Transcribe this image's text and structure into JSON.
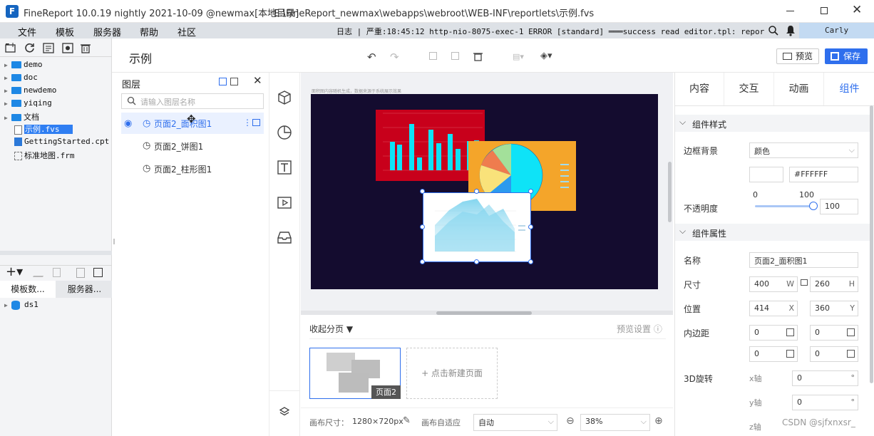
{
  "window": {
    "title": "FineReport 10.0.19 nightly 2021-10-09 @newmax[本地目录]",
    "path": "E:\\FineReport_newmax\\webapps\\webroot\\WEB-INF\\reportlets\\示例.fvs"
  },
  "menu": [
    "文件",
    "模板",
    "服务器",
    "帮助",
    "社区"
  ],
  "log": "日志 | 严重:18:45:12 http-nio-8075-exec-1 ERROR [standard] ═══success read editor.tpl: reportle...",
  "user": "Carly",
  "tree": {
    "items": [
      "demo",
      "doc",
      "newdemo",
      "yiqing",
      "文档",
      "示例.fvs",
      "GettingStarted.cpt",
      "标准地图.frm"
    ]
  },
  "datasource": {
    "tabs": [
      "模板数...",
      "服务器..."
    ],
    "item": "ds1"
  },
  "header": {
    "title": "示例",
    "preview": "预览",
    "save": "保存"
  },
  "layers": {
    "title": "图层",
    "search_placeholder": "请输入图层名称",
    "items": [
      "页面2_面积图1",
      "页面2_饼图1",
      "页面2_柱形图1"
    ]
  },
  "canvas": {
    "caption": "面积图内容随机生成，数据来源于系统展示效果"
  },
  "pages": {
    "collapse": "收起分页",
    "settings": "预览设置",
    "page_label": "页面2",
    "new_page": "+ 点击新建页面"
  },
  "bottombar": {
    "size_label": "画布尺寸：",
    "size_value": "1280×720px",
    "adapt_label": "画布自适应",
    "adapt_value": "自动",
    "zoom": "38%"
  },
  "props": {
    "tabs": [
      "内容",
      "交互",
      "动画",
      "组件"
    ],
    "style_section": "组件样式",
    "border_bg": "边框背景",
    "border_bg_value": "颜色",
    "color_hex": "#FFFFFF",
    "opacity_label": "不透明度",
    "opacity_min": "0",
    "opacity_max": "100",
    "opacity_value": "100",
    "attr_section": "组件属性",
    "name_label": "名称",
    "name_value": "页面2_面积图1",
    "size_label": "尺寸",
    "width": "400",
    "w": "W",
    "height": "260",
    "h": "H",
    "pos_label": "位置",
    "x": "414",
    "xl": "X",
    "y": "360",
    "yl": "Y",
    "padding_label": "内边距",
    "pad": [
      "0",
      "0",
      "0",
      "0"
    ],
    "rotate_label": "3D旋转",
    "axes": [
      "x轴",
      "y轴",
      "z轴"
    ],
    "rot": [
      "0",
      "0"
    ],
    "deg": "°"
  },
  "watermark": "CSDN @sjfxnxsr_",
  "colors": {
    "accent": "#2f6fed",
    "bar": "#0ee3f7"
  }
}
